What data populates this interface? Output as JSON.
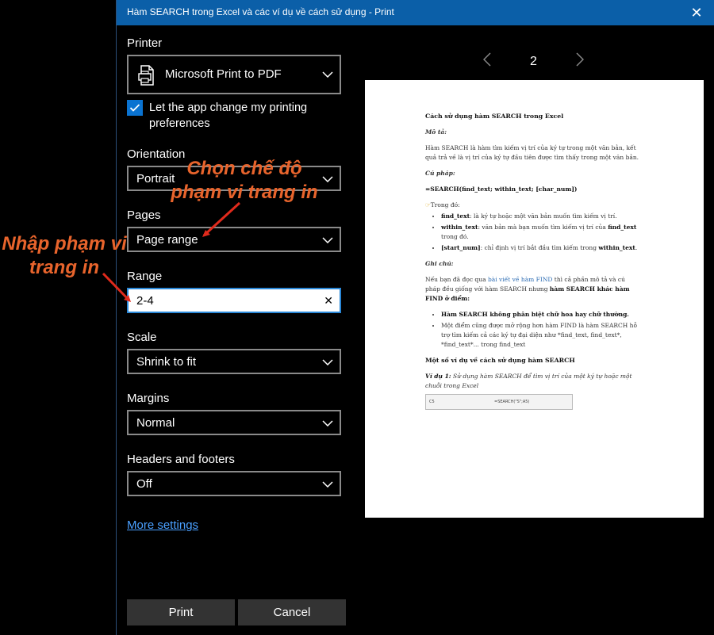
{
  "window": {
    "title": "Hàm SEARCH trong Excel và các ví dụ về cách sử dụng - Print"
  },
  "printer": {
    "label": "Printer",
    "value": "Microsoft Print to PDF"
  },
  "preferences": {
    "checked": true,
    "label_line1": "Let the app change my printing",
    "label_line2": "preferences"
  },
  "orientation": {
    "label": "Orientation",
    "value": "Portrait"
  },
  "pages": {
    "label": "Pages",
    "value": "Page range"
  },
  "range": {
    "label": "Range",
    "value": "2-4"
  },
  "scale": {
    "label": "Scale",
    "value": "Shrink to fit"
  },
  "margins": {
    "label": "Margins",
    "value": "Normal"
  },
  "headers": {
    "label": "Headers and footers",
    "value": "Off"
  },
  "more_settings": "More settings",
  "buttons": {
    "print": "Print",
    "cancel": "Cancel"
  },
  "pager": {
    "page": "2"
  },
  "annotations": {
    "pages_mode_line1": "Chọn chế độ",
    "pages_mode_line2": "phạm vi trang in",
    "range_input_line1": "Nhập phạm vi",
    "range_input_line2": "trang in",
    "color": "#e8642c"
  },
  "preview_doc": {
    "heading": "Cách sử dụng hàm SEARCH trong Excel",
    "mota_title": "Mô tả:",
    "mota_text": "Hàm SEARCH là hàm tìm kiếm vị trí của ký tự trong một văn bản, kết quả trả về là vị trí của ký tự đầu tiên được tìm thấy trong một văn bản.",
    "cuphap_title": "Cú pháp:",
    "syntax": "=SEARCH(find_text; within_text; [char_num])",
    "trongdo": "Trong đó:",
    "args": [
      {
        "name": "find_text",
        "desc": ": là ký tự hoặc một văn bản muốn tìm kiếm vị trí."
      },
      {
        "name": "within_text",
        "desc": ": văn bản mà bạn muốn tìm kiếm vị trí của ",
        "name2": "find_text",
        "desc2": " trong đó."
      },
      {
        "name": "[start_num]",
        "desc": ": chỉ định vị trí bắt đầu tìm kiếm trong ",
        "name2": "within_text",
        "desc2": "."
      }
    ],
    "ghichu_title": "Ghi chú:",
    "ghichu_p1": "Nếu bạn đã đọc qua ",
    "ghichu_link": "bài viết về hàm FIND",
    "ghichu_p2": " thì cả phần mô tả và cú pháp đều giống với hàm SEARCH nhưng ",
    "ghichu_bold": "hàm SEARCH khác hàm FIND ở điểm:",
    "notes": [
      "Hàm SEARCH không phân biệt chữ hoa hay chữ thường.",
      "Một điểm cũng được mở rộng hơn hàm FIND là hàm SEARCH hỗ trợ tìm kiếm cả các ký tự đại diện như *find_text, find_text*, *find_text*... trong find_text"
    ],
    "examples_title": "Một số ví dụ về cách sử dụng hàm SEARCH",
    "example1_label": "Ví dụ 1:",
    "example1_text": " Sử dụng hàm SEARCH để tìm vị trí của một ký tự hoặc một chuỗi trong Excel",
    "mini_cell": "C5",
    "mini_formula": "=SEARCH(\"S\";A5)"
  }
}
